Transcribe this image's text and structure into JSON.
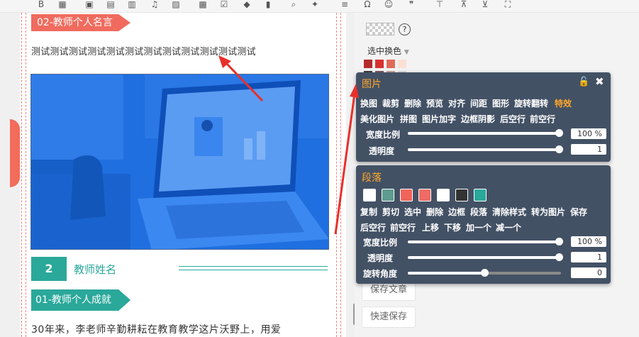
{
  "toolbar": {
    "icons": [
      "bold-icon",
      "table-icon",
      "image-icon",
      "image-gallery-icon",
      "video-icon",
      "music-icon",
      "chart-icon",
      "template-icon",
      "checkbox-icon",
      "tag-icon",
      "bookmark-icon",
      "search-replace-icon",
      "magic-icon",
      "divider-icon",
      "omega-icon",
      "emoji-icon",
      "quote-icon",
      "insert-row-icon",
      "format-clear-icon",
      "download-icon",
      "fullscreen-icon"
    ]
  },
  "editor": {
    "quote_header": "02-教师个人名言",
    "quote_text": "测试测试测试测试测试测试测试测试测试测试测试测试",
    "number_badge": "2",
    "teacher_name": "教师姓名",
    "achieve_header": "01-教师个人成就",
    "body_text": "30年来，李老师辛勤耕耘在教育教学这片沃野上，用爱"
  },
  "sidebar": {
    "color_select": "选中换色",
    "buttons": [
      "保存文章",
      "快速保存"
    ],
    "swatch_colors": [
      "#b52a2a",
      "#d9312f",
      "#e06a5a",
      "#fbe0d6",
      "#3c3c3c",
      "#7a5a5a",
      "#c9a29a",
      "#d9d9d9"
    ]
  },
  "panel_image": {
    "title": "图片",
    "actions_row1": [
      "换图",
      "裁剪",
      "删除",
      "预览",
      "对齐",
      "间距",
      "图形",
      "旋转翻转",
      "特效"
    ],
    "active_action": "特效",
    "actions_row2": [
      "美化图片",
      "拼图",
      "图片加字",
      "边框阴影",
      "后空行",
      "前空行"
    ],
    "width_label": "宽度比例",
    "width_value": "100 %",
    "width_level": 1.0,
    "opacity_label": "透明度",
    "opacity_value": "1",
    "opacity_level": 1.0
  },
  "panel_para": {
    "title": "段落",
    "swatches": [
      "#ffffff",
      "#5e9c8f",
      "#f0645a",
      "#f06b66",
      "#ffffff",
      "#333333",
      "#2aa89a"
    ],
    "actions_row1": [
      "复制",
      "剪切",
      "选中",
      "删除",
      "边框",
      "段落",
      "清除样式",
      "转为图片",
      "保存"
    ],
    "actions_row2": [
      "后空行",
      "前空行",
      "上移",
      "下移",
      "加一个",
      "减一个"
    ],
    "width_label": "宽度比例",
    "width_value": "100 %",
    "width_level": 1.0,
    "opacity_label": "透明度",
    "opacity_value": "1",
    "opacity_level": 1.0,
    "rotate_label": "旋转角度",
    "rotate_value": "0",
    "rotate_level": 0.5
  },
  "colors": {
    "accent_red": "#f06b5e",
    "accent_teal": "#2aa89a",
    "panel_bg": "#435165",
    "panel_title": "#ffa72b",
    "annotation_arrow": "#e8302a"
  }
}
